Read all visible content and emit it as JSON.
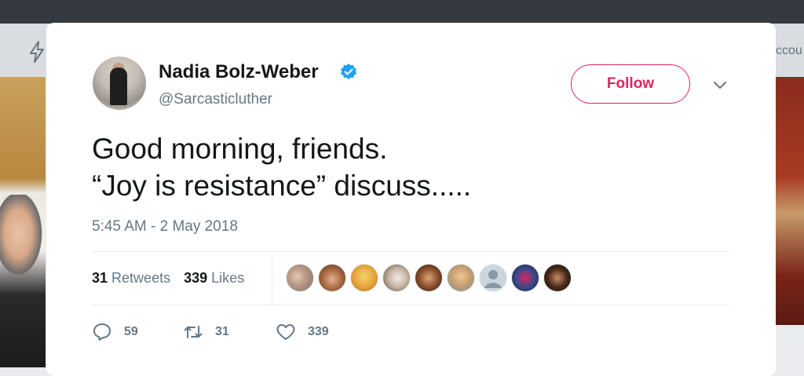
{
  "background": {
    "partial_text": "ccou"
  },
  "tweet": {
    "author_name": "Nadia Bolz-Weber",
    "author_handle": "@Sarcasticluther",
    "verified": true,
    "follow_label": "Follow",
    "text_line1": "Good morning, friends.",
    "text_line2": "“Joy is resistance” discuss.....",
    "timestamp": "5:45 AM - 2 May 2018",
    "stats": {
      "retweets_count": "31",
      "retweets_label": "Retweets",
      "likes_count": "339",
      "likes_label": "Likes"
    },
    "likers_shown": 9,
    "actions": {
      "reply_count": "59",
      "retweet_count": "31",
      "like_count": "339"
    }
  },
  "colors": {
    "accent": "#e0245e",
    "verified": "#1da1f2",
    "secondary_text": "#657786",
    "primary_text": "#14171a"
  },
  "icons": [
    "bolt-icon",
    "verified-badge-icon",
    "chevron-down-icon",
    "reply-icon",
    "retweet-icon",
    "heart-icon"
  ]
}
